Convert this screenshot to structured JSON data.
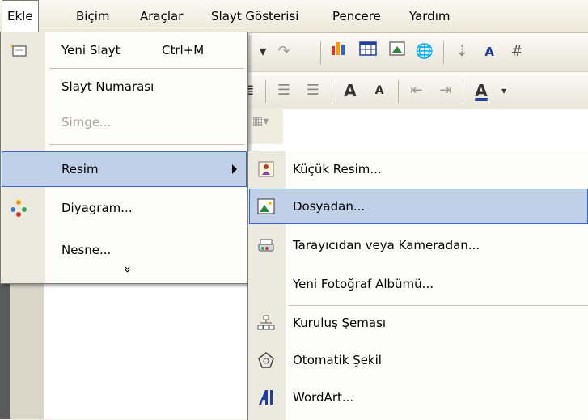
{
  "menubar": {
    "items": [
      "Ekle",
      "Biçim",
      "Araçlar",
      "Slayt Gösterisi",
      "Pencere",
      "Yardım"
    ]
  },
  "insert_menu": {
    "new_slide": "Yeni Slayt",
    "new_slide_shortcut": "Ctrl+M",
    "slide_number": "Slayt Numarası",
    "symbol": "Simge...",
    "picture": "Resim",
    "diagram": "Diyagram...",
    "object": "Nesne...",
    "expand": "»"
  },
  "picture_submenu": {
    "clip_art": "Küçük Resim...",
    "from_file": "Dosyadan...",
    "from_scanner": "Tarayıcıdan veya Kameradan...",
    "new_album": "Yeni Fotoğraf Albümü...",
    "org_chart": "Kuruluş Şeması",
    "autoshapes": "Otomatik Şekil",
    "wordart": "WordArt..."
  },
  "colors": {
    "highlight": "#c0d0e8",
    "highlight_border": "#3169c6",
    "gutter": "#eceade"
  }
}
